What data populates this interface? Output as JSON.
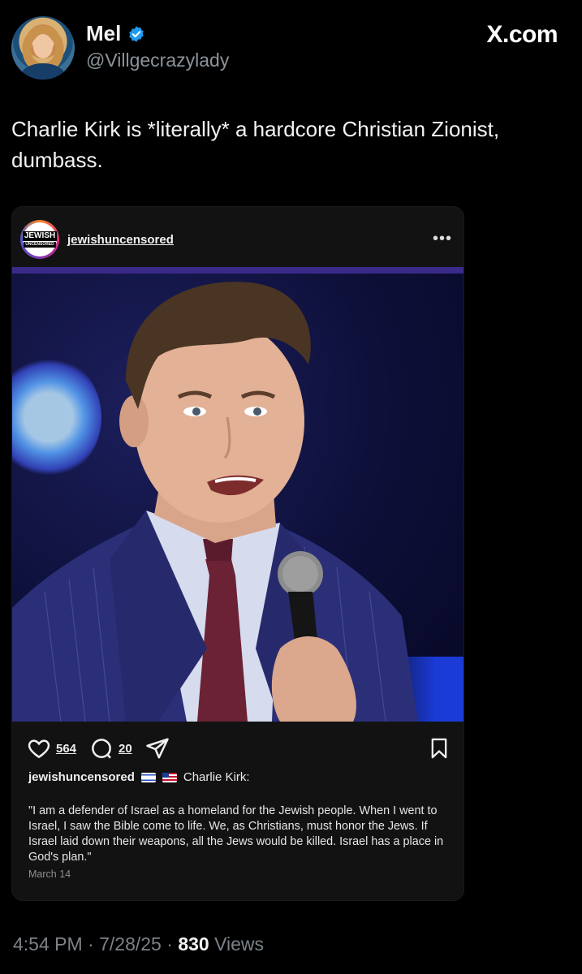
{
  "header": {
    "name": "Mel",
    "handle": "@Villgecrazylady",
    "site_logo": "X.com"
  },
  "tweet": {
    "text": "Charlie Kirk is *literally* a hardcore Christian Zionist, dumbass."
  },
  "embed": {
    "avatar_line1": "JEWISH",
    "avatar_line2": "UNCENSORED",
    "username": "jewishuncensored",
    "more_label": "•••",
    "likes": "564",
    "comments": "20",
    "caption_user": "jewishuncensored",
    "caption_text": "Charlie Kirk:",
    "quote": "\"I am a defender of Israel as a homeland for the Jewish people. When I went to Israel, I saw the Bible come to life. We, as Christians, must honor the Jews. If Israel laid down their weapons, all the Jews would be killed. Israel has a place in God's plan.\"",
    "date": "March 14"
  },
  "footer": {
    "time": "4:54 PM",
    "sep1": " · ",
    "date": "7/28/25",
    "sep2": " · ",
    "views_count": "830",
    "views_label": " Views"
  },
  "colors": {
    "background": "#000000",
    "verified": "#1d9bf0",
    "card_bg": "#121212",
    "muted_text": "#7b8288"
  }
}
